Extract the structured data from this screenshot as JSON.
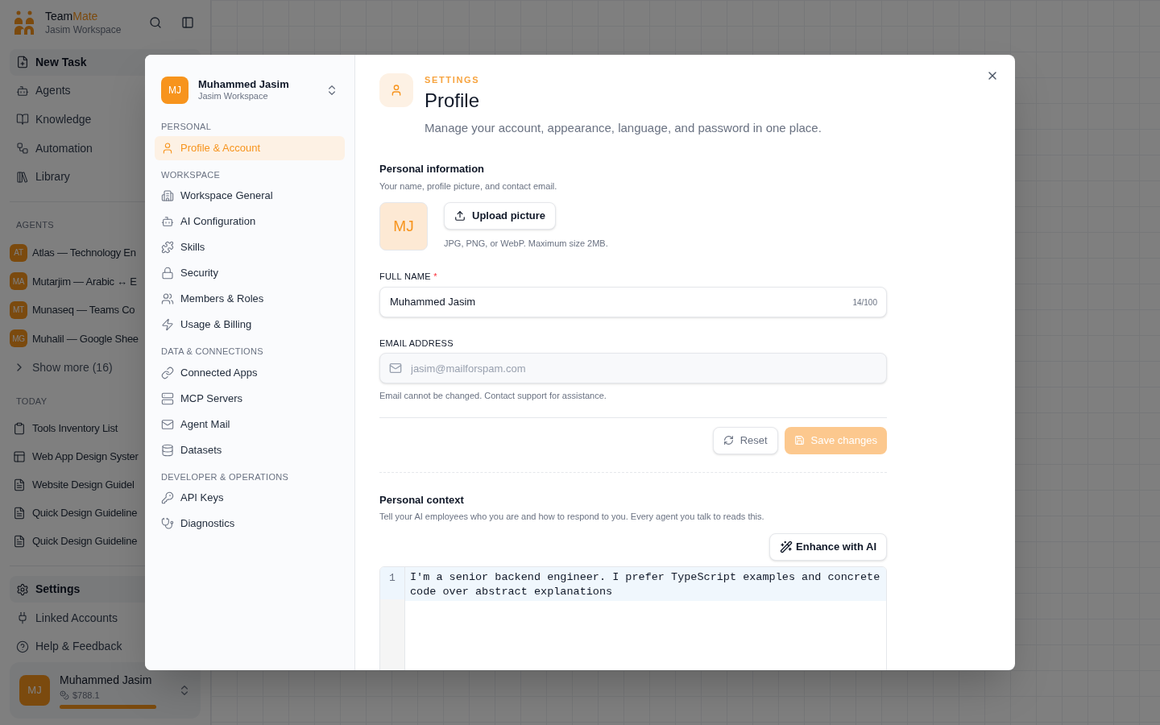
{
  "app": {
    "brand": {
      "prefix": "Team",
      "accent": "Mate"
    },
    "workspace": "Jasim Workspace",
    "nav": [
      {
        "label": "New Task",
        "selected": true
      },
      {
        "label": "Agents",
        "selected": false
      },
      {
        "label": "Knowledge",
        "selected": false
      },
      {
        "label": "Automation",
        "selected": false
      },
      {
        "label": "Library",
        "selected": false
      }
    ],
    "agents_heading": "AGENTS",
    "agents": [
      {
        "initials": "AT",
        "name": "Atlas — Technology En"
      },
      {
        "initials": "MA",
        "name": "Mutarjim — Arabic ↔ E"
      },
      {
        "initials": "MT",
        "name": "Munaseq — Teams Co"
      },
      {
        "initials": "MG",
        "name": "Muhalil — Google Shee"
      }
    ],
    "show_more": "Show more (16)",
    "today_heading": "TODAY",
    "today": [
      "Tools Inventory List",
      "Web App Design Syster",
      "Website Design Guidel",
      "Quick Design Guideline",
      "Quick Design Guideline"
    ],
    "footer_nav": [
      {
        "label": "Settings",
        "selected": true
      },
      {
        "label": "Linked Accounts",
        "selected": false
      },
      {
        "label": "Help & Feedback",
        "selected": false
      }
    ],
    "user": {
      "initials": "MJ",
      "name": "Muhammed Jasim",
      "balance": "$788.1",
      "level": 1
    }
  },
  "modal": {
    "user": {
      "initials": "MJ",
      "name": "Muhammed Jasim",
      "workspace": "Jasim Workspace"
    },
    "sections": [
      {
        "heading": "PERSONAL",
        "items": [
          {
            "label": "Profile & Account",
            "selected": true
          }
        ]
      },
      {
        "heading": "WORKSPACE",
        "items": [
          {
            "label": "Workspace General",
            "selected": false
          },
          {
            "label": "AI Configuration",
            "selected": false
          },
          {
            "label": "Skills",
            "selected": false
          },
          {
            "label": "Security",
            "selected": false
          },
          {
            "label": "Members & Roles",
            "selected": false
          },
          {
            "label": "Usage & Billing",
            "selected": false
          }
        ]
      },
      {
        "heading": "DATA & CONNECTIONS",
        "items": [
          {
            "label": "Connected Apps",
            "selected": false
          },
          {
            "label": "MCP Servers",
            "selected": false
          },
          {
            "label": "Agent Mail",
            "selected": false
          },
          {
            "label": "Datasets",
            "selected": false
          }
        ]
      },
      {
        "heading": "DEVELOPER & OPERATIONS",
        "items": [
          {
            "label": "API Keys",
            "selected": false
          },
          {
            "label": "Diagnostics",
            "selected": false
          }
        ]
      }
    ],
    "eyebrow": "SETTINGS",
    "title": "Profile",
    "subtitle": "Manage your account, appearance, language, and password in one place.",
    "personal_info": {
      "title": "Personal information",
      "description": "Your name, profile picture, and contact email.",
      "avatar": "MJ",
      "upload_button": "Upload picture",
      "upload_hint": "JPG, PNG, or WebP. Maximum size 2MB."
    },
    "full_name": {
      "label": "FULL NAME",
      "required_mark": "*",
      "value": "Muhammed Jasim",
      "counter": "14/100"
    },
    "email": {
      "label": "EMAIL ADDRESS",
      "value": "jasim@mailforspam.com",
      "disabled": true,
      "hint": "Email cannot be changed. Contact support for assistance."
    },
    "reset_button": "Reset",
    "save_button": {
      "label": "Save changes",
      "disabled": true
    },
    "personal_context": {
      "title": "Personal context",
      "description": "Tell your AI employees who you are and how to respond to you. Every agent you talk to reads this.",
      "enhance_button": "Enhance with AI",
      "editor": {
        "lines": [
          {
            "number": "1",
            "text": "I'm a senior backend engineer. I prefer TypeScript examples and concrete code over abstract explanations"
          }
        ]
      }
    }
  }
}
